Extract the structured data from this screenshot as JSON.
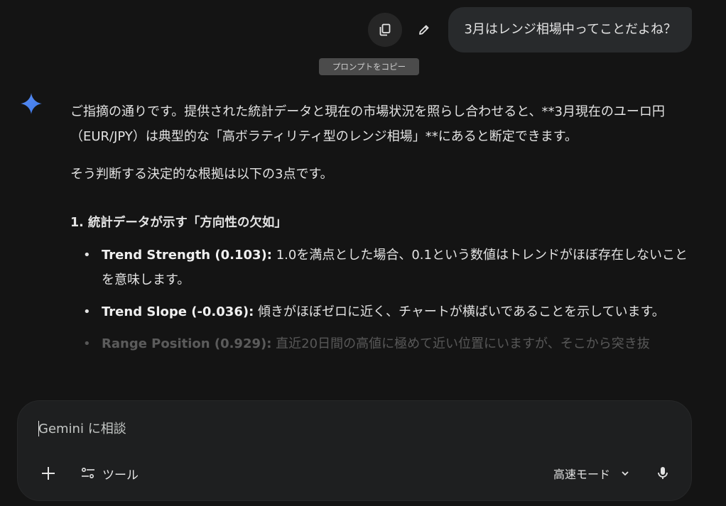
{
  "user_message": {
    "text": "3月はレンジ相場中ってことだよね？",
    "copy_tooltip": "プロンプトをコピー"
  },
  "response": {
    "paragraph1": "ご指摘の通りです。提供された統計データと現在の市場状況を照らし合わせると、**3月現在のユーロ円（EUR/JPY）は典型的な「高ボラティリティ型のレンジ相場」**にあると断定できます。",
    "paragraph2": "そう判断する決定的な根拠は以下の3点です。",
    "section_title": "1. 統計データが示す「方向性の欠如」",
    "bullets": [
      {
        "term": "Trend Strength (0.103):",
        "text": " 1.0を満点とした場合、0.1という数値はトレンドがほぼ存在しないことを意味します。"
      },
      {
        "term": "Trend Slope (-0.036):",
        "text": " 傾きがほぼゼロに近く、チャートが横ばいであることを示しています。"
      },
      {
        "term": "Range Position (0.929):",
        "text": " 直近20日間の高値に極めて近い位置にいますが、そこから突き抜"
      }
    ]
  },
  "composer": {
    "placeholder": "Gemini に相談",
    "tools_label": "ツール",
    "mode_label": "高速モード"
  },
  "icons": {
    "copy": "copy-icon",
    "edit": "pencil-icon",
    "spark": "gemini-spark-icon",
    "plus": "plus-icon",
    "tools": "tune-icon",
    "chevron": "chevron-down-icon",
    "mic": "mic-icon"
  },
  "colors": {
    "background": "#141414",
    "bubble": "#282a2c",
    "composer": "#1e1f20",
    "spark_blue": "#4285f4"
  }
}
